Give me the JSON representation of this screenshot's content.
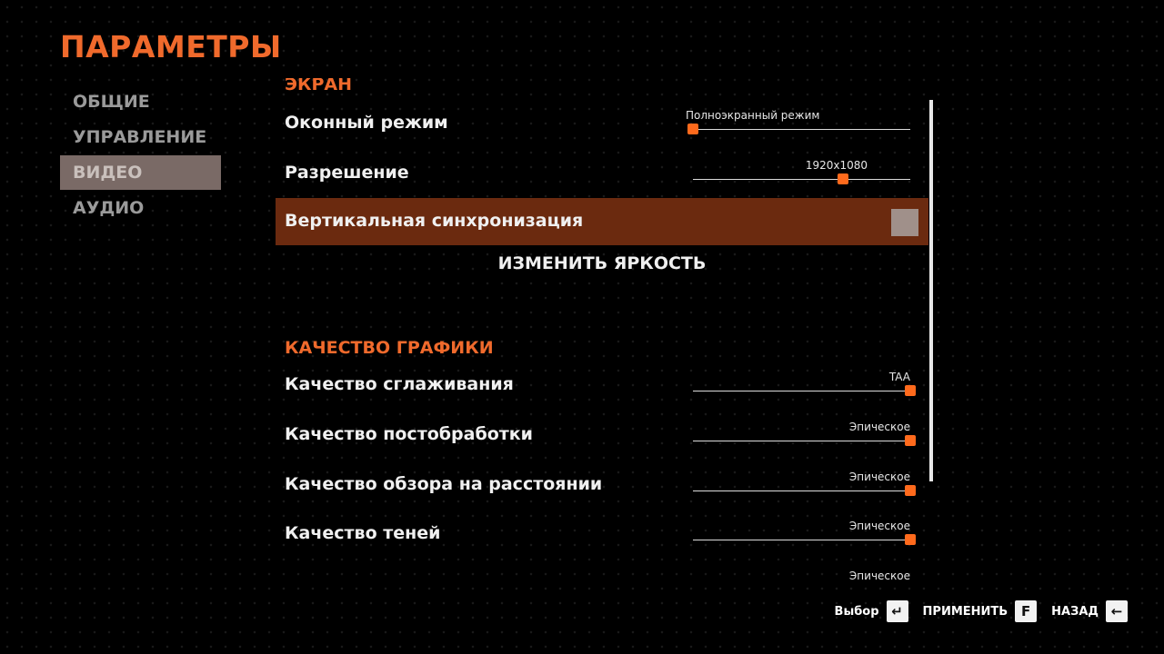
{
  "title": "ПАРАМЕТРЫ",
  "nav": [
    {
      "label": "ОБЩИЕ"
    },
    {
      "label": "УПРАВЛЕНИЕ"
    },
    {
      "label": "ВИДЕО"
    },
    {
      "label": "АУДИО"
    }
  ],
  "screen_section": {
    "heading": "ЭКРАН",
    "window_mode": {
      "label": "Оконный режим",
      "value": "Полноэкранный режим",
      "level": 0
    },
    "resolution": {
      "label": "Разрешение",
      "value": "1920x1080",
      "level": 0.69
    },
    "vsync": {
      "label": "Вертикальная синхронизация",
      "checked": false
    },
    "brightness": {
      "label": "ИЗМЕНИТЬ ЯРКОСТЬ"
    }
  },
  "graphics_section": {
    "heading": "КАЧЕСТВО ГРАФИКИ",
    "antialiasing": {
      "label": "Качество сглаживания",
      "value": "TAA",
      "level": 1
    },
    "postprocess": {
      "label": "Качество постобработки",
      "value": "Эпическое",
      "level": 1
    },
    "view_distance": {
      "label": "Качество обзора на расстоянии",
      "value": "Эпическое",
      "level": 1
    },
    "shadows": {
      "label": "Качество теней",
      "value": "Эпическое",
      "level": 1
    },
    "next_value": "Эпическое"
  },
  "footer": {
    "select": {
      "label": "Выбор",
      "key": "↵"
    },
    "apply": {
      "label": "ПРИМЕНИТЬ",
      "key": "F"
    },
    "back": {
      "label": "НАЗАД",
      "key": "←"
    }
  },
  "colors": {
    "accent": "#f06a2c",
    "selected_row": "#6b2a0f",
    "active_nav": "#7a6a66"
  }
}
